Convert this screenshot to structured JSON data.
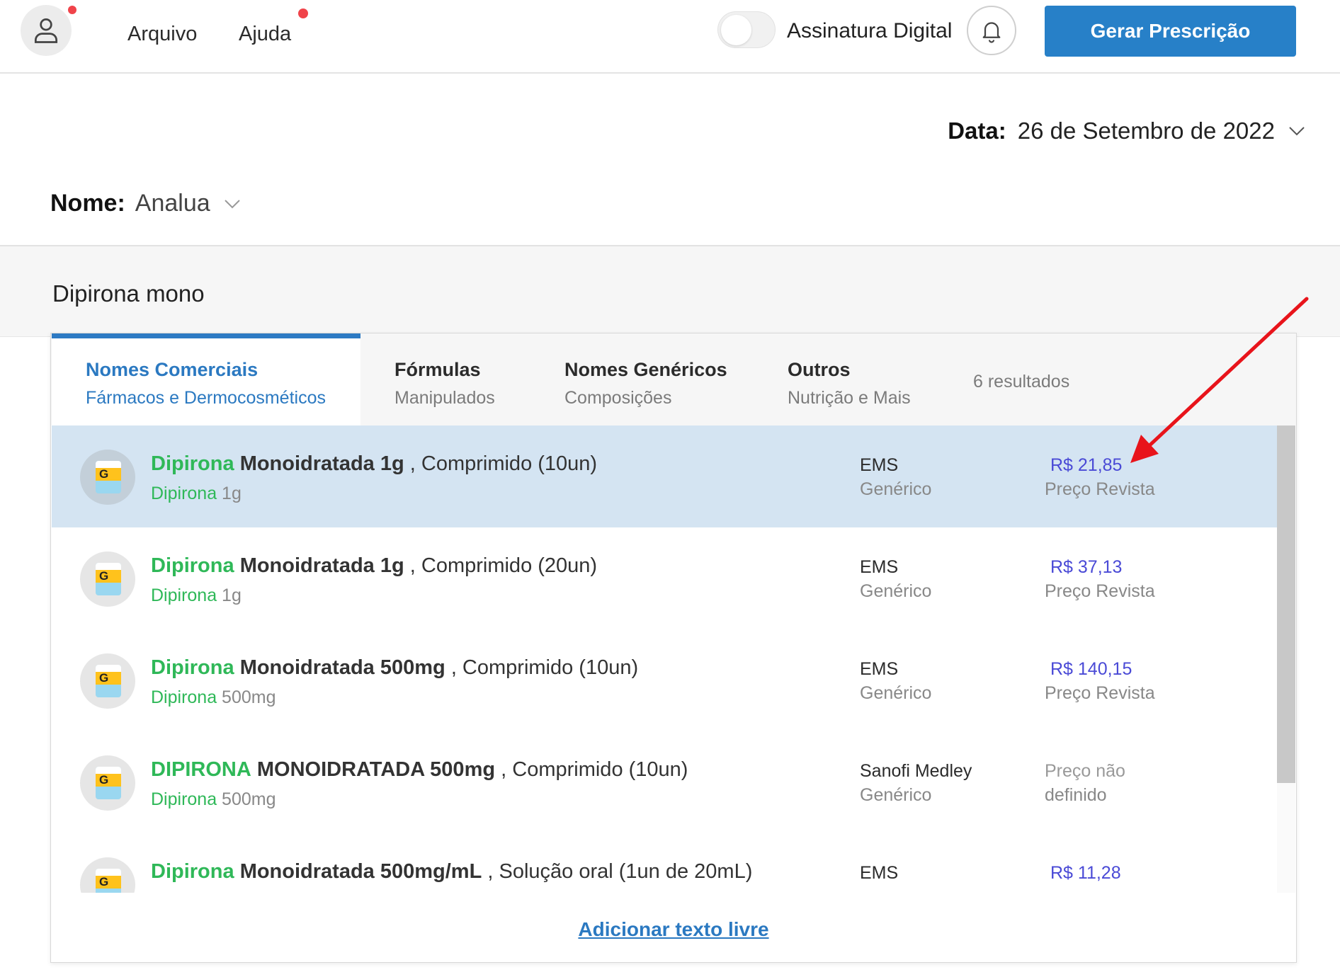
{
  "header": {
    "menu": [
      "Arquivo",
      "Ajuda"
    ],
    "toggle_label": "Assinatura Digital",
    "primary_button": "Gerar Prescrição"
  },
  "form": {
    "date_label": "Data:",
    "date_value": "26 de Setembro de 2022",
    "name_label": "Nome:",
    "name_value": "Analua",
    "search_value": "Dipirona mono"
  },
  "tabs": [
    {
      "title": "Nomes Comerciais",
      "subtitle": "Fármacos e Dermocosméticos"
    },
    {
      "title": "Fórmulas",
      "subtitle": "Manipulados"
    },
    {
      "title": "Nomes Genéricos",
      "subtitle": "Composições"
    },
    {
      "title": "Outros",
      "subtitle": "Nutrição e Mais"
    }
  ],
  "results_count": "6 resultados",
  "icon_letter": "G",
  "results": [
    {
      "brand": "Dipirona",
      "strength": "Monoidratada 1g",
      "form": ", Comprimido (10un)",
      "sub_name": "Dipirona",
      "sub_dose": " 1g",
      "maker": "EMS",
      "maker_type": "Genérico",
      "price": "R$ 21,85",
      "price_label": "Preço Revista"
    },
    {
      "brand": "Dipirona",
      "strength": "Monoidratada 1g",
      "form": ", Comprimido (20un)",
      "sub_name": "Dipirona",
      "sub_dose": " 1g",
      "maker": "EMS",
      "maker_type": "Genérico",
      "price": "R$ 37,13",
      "price_label": "Preço Revista"
    },
    {
      "brand": "Dipirona",
      "strength": "Monoidratada 500mg",
      "form": ", Comprimido (10un)",
      "sub_name": "Dipirona",
      "sub_dose": " 500mg",
      "maker": "EMS",
      "maker_type": "Genérico",
      "price": "R$ 140,15",
      "price_label": "Preço Revista"
    },
    {
      "brand": "DIPIRONA",
      "strength": "MONOIDRATADA 500mg",
      "form": ", Comprimido (10un)",
      "sub_name": "Dipirona",
      "sub_dose": " 500mg",
      "maker": "Sanofi Medley",
      "maker_type": "Genérico",
      "price": "Preço não",
      "price_label": "definido"
    },
    {
      "brand": "Dipirona",
      "strength": "Monoidratada 500mg/mL",
      "form": ", Solução oral (1un de 20mL)",
      "sub_name": "",
      "sub_dose": "",
      "maker": "EMS",
      "maker_type": "",
      "price": "R$ 11,28",
      "price_label": ""
    }
  ],
  "free_text_link": "Adicionar texto livre",
  "colors": {
    "accent": "#2780c8",
    "brand_green": "#2fb858",
    "price_blue": "#4a4ad6",
    "selected_row": "#d4e4f2",
    "notification_dot": "#f0434a",
    "annotation_arrow": "#e8141b"
  }
}
